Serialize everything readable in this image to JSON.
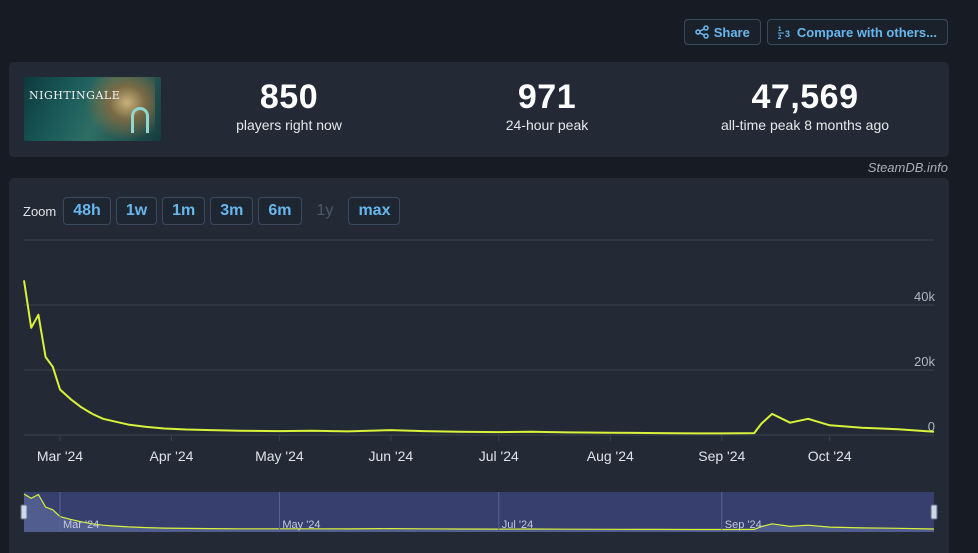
{
  "actions": {
    "share_label": "Share",
    "compare_label": "Compare with others..."
  },
  "game": {
    "logo_text": "NIGHTINGALE"
  },
  "stats": {
    "current": {
      "value": "850",
      "label": "players right now"
    },
    "peak24": {
      "value": "971",
      "label": "24-hour peak"
    },
    "alltime": {
      "value": "47,569",
      "label": "all-time peak 8 months ago"
    }
  },
  "credit": "SteamDB.info",
  "zoom": {
    "label": "Zoom",
    "buttons": [
      {
        "label": "48h",
        "enabled": true
      },
      {
        "label": "1w",
        "enabled": true
      },
      {
        "label": "1m",
        "enabled": true
      },
      {
        "label": "3m",
        "enabled": true
      },
      {
        "label": "6m",
        "enabled": true
      },
      {
        "label": "1y",
        "enabled": false
      },
      {
        "label": "max",
        "enabled": true
      }
    ]
  },
  "colors": {
    "line": "#d9f23a",
    "grid": "#3a4350",
    "navigator_bg": "#3b4378"
  },
  "chart_data": {
    "type": "line",
    "title": "",
    "xlabel": "",
    "ylabel": "",
    "ylim": [
      0,
      60000
    ],
    "y_ticks": [
      0,
      20000,
      40000
    ],
    "y_tick_labels": [
      "0",
      "20k",
      "40k"
    ],
    "x_ticks": [
      "2024-03-01",
      "2024-04-01",
      "2024-05-01",
      "2024-06-01",
      "2024-07-01",
      "2024-08-01",
      "2024-09-01",
      "2024-10-01"
    ],
    "x_tick_labels": [
      "Mar '24",
      "Apr '24",
      "May '24",
      "Jun '24",
      "Jul '24",
      "Aug '24",
      "Sep '24",
      "Oct '24"
    ],
    "navigator_tick_labels": [
      "Mar '24",
      "May '24",
      "Jul '24",
      "Sep '24"
    ],
    "grid": true,
    "series": [
      {
        "x": [
          "2024-02-20",
          "2024-02-22",
          "2024-02-24",
          "2024-02-26",
          "2024-02-28",
          "2024-03-01",
          "2024-03-04",
          "2024-03-07",
          "2024-03-10",
          "2024-03-13",
          "2024-03-16",
          "2024-03-20",
          "2024-03-25",
          "2024-03-30",
          "2024-04-05",
          "2024-04-12",
          "2024-04-20",
          "2024-05-01",
          "2024-05-10",
          "2024-05-20",
          "2024-06-01",
          "2024-06-10",
          "2024-06-20",
          "2024-07-01",
          "2024-07-10",
          "2024-07-20",
          "2024-08-01",
          "2024-08-15",
          "2024-08-25",
          "2024-09-01",
          "2024-09-10",
          "2024-09-12",
          "2024-09-15",
          "2024-09-20",
          "2024-09-25",
          "2024-10-01",
          "2024-10-10",
          "2024-10-20",
          "2024-10-30"
        ],
        "y": [
          47569,
          33000,
          37000,
          24000,
          21000,
          14000,
          11000,
          8500,
          6500,
          5000,
          4200,
          3200,
          2500,
          2000,
          1700,
          1500,
          1300,
          1200,
          1300,
          1100,
          1500,
          1200,
          1000,
          900,
          1000,
          800,
          700,
          600,
          500,
          500,
          600,
          3500,
          6500,
          3800,
          5000,
          3000,
          2200,
          1800,
          1000
        ]
      }
    ]
  }
}
